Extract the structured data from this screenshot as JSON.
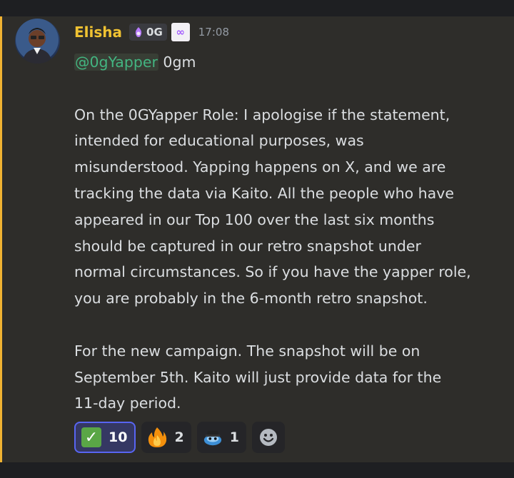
{
  "message": {
    "author": "Elisha",
    "role_tag": "0G",
    "badge_icon": "infinity-badge-icon",
    "timestamp": "17:08",
    "mention": "@0gYapper",
    "first_line_rest": " 0gm",
    "paragraph1": [
      "On the 0GYapper Role: I apologise if the statement,",
      "intended for educational purposes, was",
      "misunderstood. Yapping happens on X, and we are",
      "tracking the data via Kaito. All the people who have",
      "appeared in our Top 100 over the last six months",
      "should be captured in our retro snapshot under",
      "normal circumstances. So if you have the yapper role,",
      "you are probably in the 6-month retro snapshot."
    ],
    "paragraph2": [
      "For the new campaign. The snapshot will be on",
      "September 5th. Kaito will just provide data for the",
      "11-day period."
    ]
  },
  "reactions": [
    {
      "emoji": "check-mark-icon",
      "count": "10",
      "selected": true
    },
    {
      "emoji": "fire-icon",
      "count": "2",
      "selected": false
    },
    {
      "emoji": "custom-blue-emoji-icon",
      "count": "1",
      "selected": false
    }
  ],
  "add_reaction_icon": "smiley-icon",
  "colors": {
    "username": "#f0c232",
    "mention_stripe": "#f0b232",
    "mention_text": "#43b581",
    "selected_reaction_border": "#5865f2"
  }
}
